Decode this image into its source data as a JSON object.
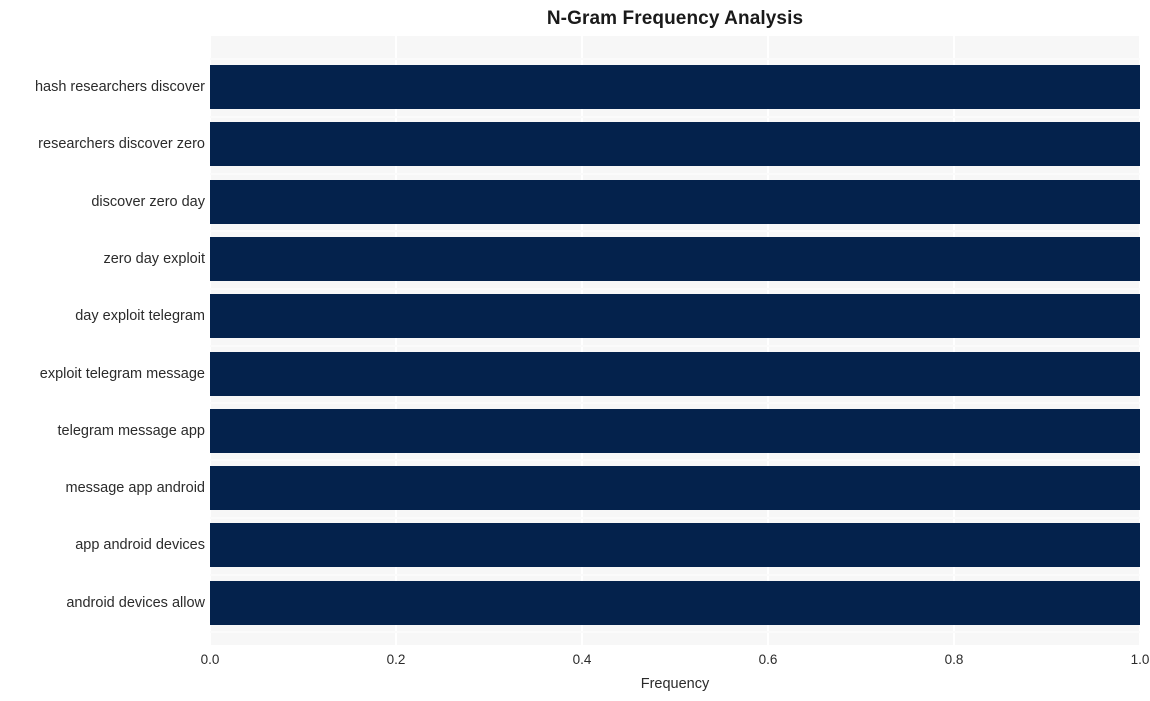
{
  "chart_data": {
    "type": "bar",
    "orientation": "horizontal",
    "title": "N-Gram Frequency Analysis",
    "xlabel": "Frequency",
    "ylabel": "",
    "xlim": [
      0.0,
      1.0
    ],
    "x_ticks": [
      "0.0",
      "0.2",
      "0.4",
      "0.6",
      "0.8",
      "1.0"
    ],
    "x_tick_values": [
      0.0,
      0.2,
      0.4,
      0.6,
      0.8,
      1.0
    ],
    "grid": true,
    "legend": "none",
    "bar_color": "#04224c",
    "plot_background": "#f7f7f7",
    "categories": [
      "hash researchers discover",
      "researchers discover zero",
      "discover zero day",
      "zero day exploit",
      "day exploit telegram",
      "exploit telegram message",
      "telegram message app",
      "message app android",
      "app android devices",
      "android devices allow"
    ],
    "values": [
      1.0,
      1.0,
      1.0,
      1.0,
      1.0,
      1.0,
      1.0,
      1.0,
      1.0,
      1.0
    ]
  }
}
